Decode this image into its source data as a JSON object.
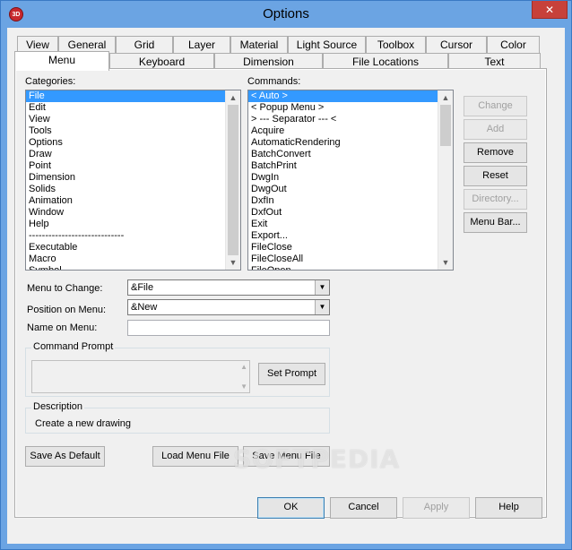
{
  "window": {
    "title": "Options",
    "close_glyph": "✕",
    "icon_text": "3D"
  },
  "tabs_row1": [
    "View",
    "General",
    "Grid",
    "Layer",
    "Material",
    "Light Source",
    "Toolbox",
    "Cursor",
    "Color"
  ],
  "tabs_row2": [
    "Menu",
    "Keyboard",
    "Dimension",
    "File Locations",
    "Text"
  ],
  "active_tab": "Menu",
  "categories": {
    "label": "Categories:",
    "items": [
      "File",
      "Edit",
      "View",
      "Tools",
      "Options",
      "Draw",
      "Point",
      "Dimension",
      "Solids",
      "Animation",
      "Window",
      "Help",
      "-----------------------------",
      "Executable",
      "Macro",
      "Symbol"
    ],
    "selected": "File"
  },
  "commands": {
    "label": "Commands:",
    "items": [
      "< Auto >",
      "< Popup Menu >",
      "> --- Separator --- <",
      "Acquire",
      "AutomaticRendering",
      "BatchConvert",
      "BatchPrint",
      "DwgIn",
      "DwgOut",
      "DxfIn",
      "DxfOut",
      "Exit",
      "Export...",
      "FileClose",
      "FileCloseAll",
      "FileOpen"
    ],
    "selected": "< Auto >"
  },
  "side_buttons": {
    "change": "Change",
    "add": "Add",
    "remove": "Remove",
    "reset": "Reset",
    "directory": "Directory...",
    "menu_bar": "Menu Bar..."
  },
  "form": {
    "menu_to_change_label": "Menu to Change:",
    "menu_to_change_value": "&File",
    "position_label": "Position on Menu:",
    "position_value": "&New",
    "name_label": "Name on Menu:",
    "name_value": ""
  },
  "command_prompt": {
    "title": "Command Prompt",
    "set_prompt": "Set Prompt",
    "value": ""
  },
  "description": {
    "title": "Description",
    "text": "Create a new drawing"
  },
  "bottom_buttons": {
    "save_default": "Save As Default",
    "load_menu": "Load Menu File",
    "save_menu": "Save Menu File"
  },
  "dialog_buttons": {
    "ok": "OK",
    "cancel": "Cancel",
    "apply": "Apply",
    "help": "Help"
  },
  "watermark": "SOFTPEDIA"
}
